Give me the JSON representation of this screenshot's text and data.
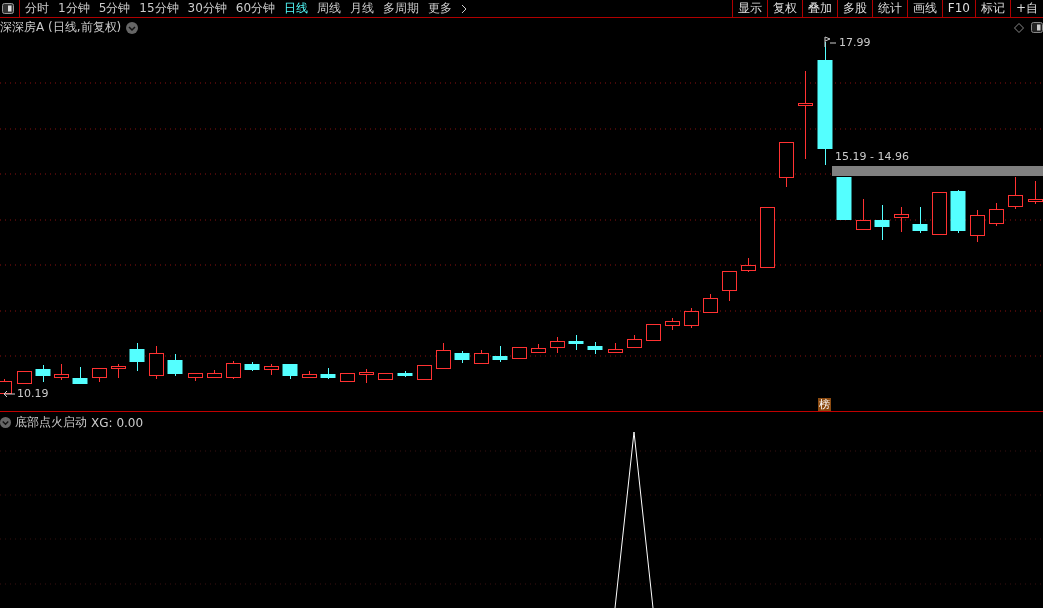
{
  "toolbar": {
    "tabs": [
      {
        "label": "分时",
        "selected": false
      },
      {
        "label": "1分钟",
        "selected": false
      },
      {
        "label": "5分钟",
        "selected": false
      },
      {
        "label": "15分钟",
        "selected": false
      },
      {
        "label": "30分钟",
        "selected": false
      },
      {
        "label": "60分钟",
        "selected": false
      },
      {
        "label": "日线",
        "selected": true
      },
      {
        "label": "周线",
        "selected": false
      },
      {
        "label": "月线",
        "selected": false
      },
      {
        "label": "多周期",
        "selected": false
      }
    ],
    "more": "更多",
    "buttons": [
      "显示",
      "复权",
      "叠加",
      "多股",
      "统计",
      "画线",
      "F10",
      "标记",
      "+自"
    ]
  },
  "main_chart": {
    "title": "深深房A (日线,前复权)",
    "high_label": "17.99",
    "low_label": "10.19",
    "range_label": "15.19 - 14.96",
    "badge": "榜"
  },
  "indicator": {
    "name": "底部点火启动",
    "reading": "XG: 0.00"
  }
}
